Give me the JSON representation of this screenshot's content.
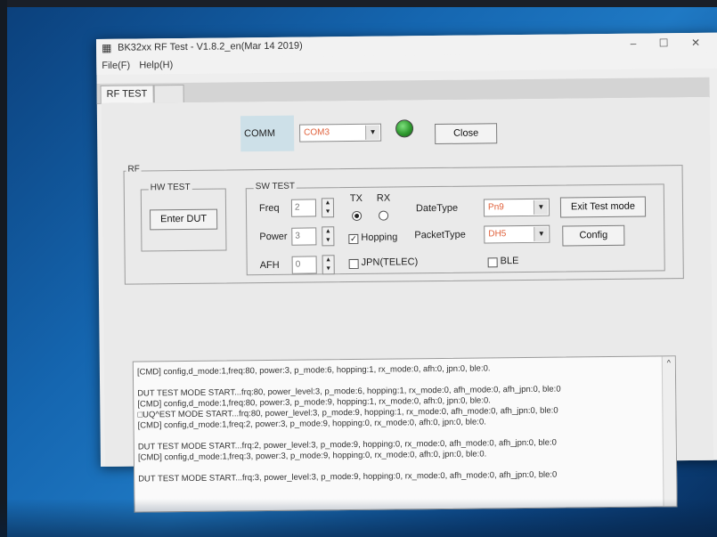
{
  "window": {
    "title": "BK32xx RF Test - V1.8.2_en(Mar 14 2019)",
    "minimize": "–",
    "maximize": "☐",
    "close": "✕"
  },
  "menu": [
    "File(F)",
    "Help(H)"
  ],
  "tabs": [
    {
      "label": "RF TEST"
    }
  ],
  "comm": {
    "label": "COMM",
    "port": "COM3",
    "close_button": "Close",
    "led_color": "#2f9a2f"
  },
  "rf": {
    "group_title": "RF",
    "hw_test": {
      "title": "HW TEST",
      "enter_dut_button": "Enter DUT"
    },
    "sw_test": {
      "title": "SW TEST",
      "freq_label": "Freq",
      "freq_value": "2",
      "power_label": "Power",
      "power_value": "3",
      "afh_label": "AFH",
      "afh_value": "0",
      "tx_label": "TX",
      "rx_label": "RX",
      "tx_selected": true,
      "hopping_label": "Hopping",
      "hopping_checked": true,
      "jpn_label": "JPN(TELEC)",
      "jpn_checked": false,
      "datetype_label": "DateType",
      "datetype_value": "Pn9",
      "packettype_label": "PacketType",
      "packettype_value": "DH5",
      "ble_label": "BLE",
      "ble_checked": false,
      "exit_button": "Exit Test mode",
      "config_button": "Config"
    }
  },
  "log": {
    "lines": [
      "[CMD] config,d_mode:1,freq:80, power:3, p_mode:6, hopping:1, rx_mode:0, afh:0, jpn:0, ble:0.",
      "",
      "DUT TEST MODE START...frq:80, power_level:3, p_mode:6, hopping:1, rx_mode:0, afh_mode:0, afh_jpn:0, ble:0",
      "[CMD] config,d_mode:1,freq:80, power:3, p_mode:9, hopping:1, rx_mode:0, afh:0, jpn:0, ble:0.",
      "□UQ^EST MODE START...frq:80, power_level:3, p_mode:9, hopping:1, rx_mode:0, afh_mode:0, afh_jpn:0, ble:0",
      "[CMD] config,d_mode:1,freq:2, power:3, p_mode:9, hopping:0, rx_mode:0, afh:0, jpn:0, ble:0.",
      "",
      "DUT TEST MODE START...frq:2, power_level:3, p_mode:9, hopping:0, rx_mode:0, afh_mode:0, afh_jpn:0, ble:0",
      "[CMD] config,d_mode:1,freq:3, power:3, p_mode:9, hopping:0, rx_mode:0, afh:0, jpn:0, ble:0.",
      "",
      "DUT TEST MODE START...frq:3, power_level:3, p_mode:9, hopping:0, rx_mode:0, afh_mode:0, afh_jpn:0, ble:0"
    ],
    "scroll_up": "^"
  }
}
